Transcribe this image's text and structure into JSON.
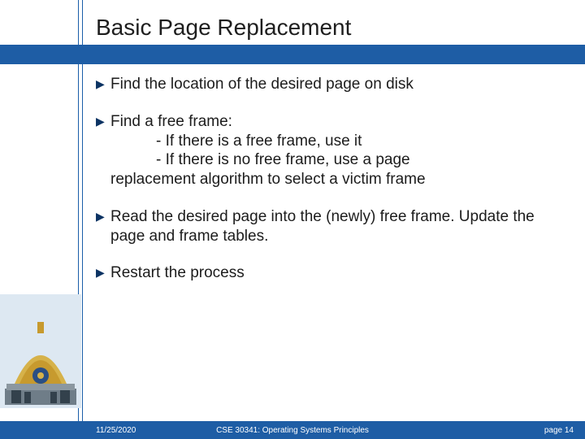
{
  "title": "Basic Page Replacement",
  "bullets": [
    {
      "text": "Find the location of the desired page on disk"
    },
    {
      "text": "Find a free frame:",
      "sub": [
        "- If there is a free frame, use it",
        "- If there is no free frame, use a page"
      ],
      "cont": "replacement algorithm to select a victim frame"
    },
    {
      "text": "Read the desired page into the (newly) free frame. Update the page and frame tables."
    },
    {
      "text": "Restart the process"
    }
  ],
  "footer": {
    "date": "11/25/2020",
    "course": "CSE 30341: Operating Systems Principles",
    "page": "page 14"
  }
}
